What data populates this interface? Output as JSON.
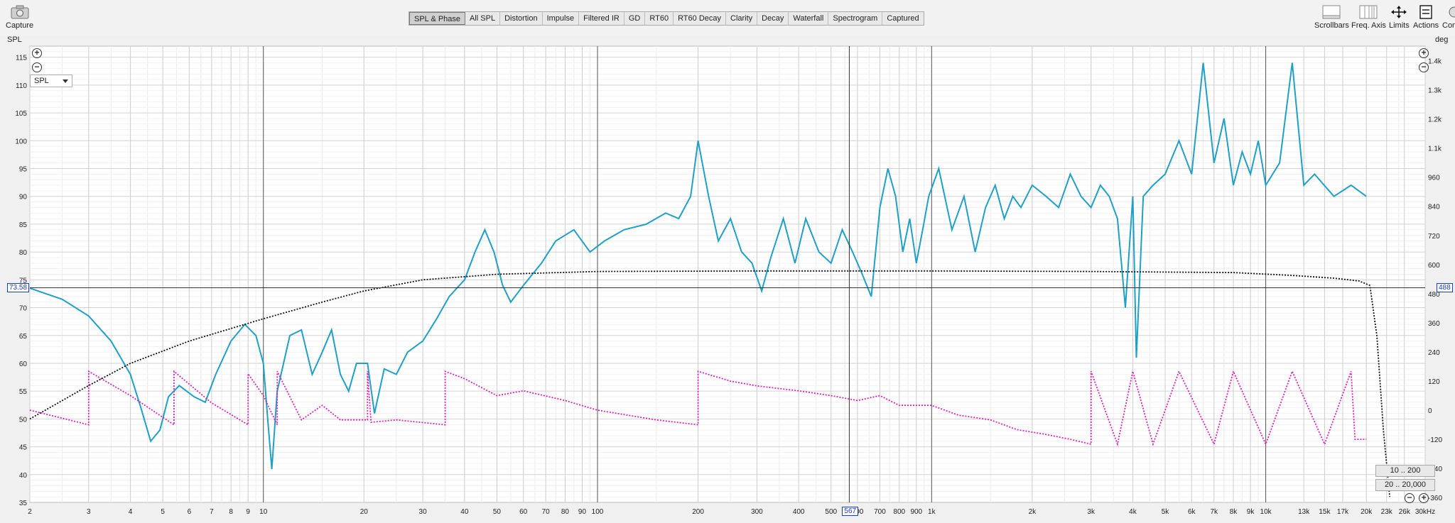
{
  "toolbar": {
    "capture_label": "Capture",
    "tabs": [
      "SPL & Phase",
      "All SPL",
      "Distortion",
      "Impulse",
      "Filtered IR",
      "GD",
      "RT60",
      "RT60 Decay",
      "Clarity",
      "Decay",
      "Waterfall",
      "Spectrogram",
      "Captured"
    ],
    "active_tab": "SPL & Phase",
    "right_buttons": [
      "Scrollbars",
      "Freq. Axis",
      "Limits",
      "Actions",
      "Con"
    ]
  },
  "plot": {
    "left_unit": "SPL",
    "right_unit": "deg",
    "dropdown_value": "SPL",
    "cursor_left_value": "73.58",
    "cursor_right_value": "488",
    "cursor_freq_value": "567",
    "range_buttons": [
      "10 .. 200",
      "20 .. 20,000"
    ],
    "colors": {
      "spl": "#1ea0c8",
      "phase": "#e020b8",
      "group": "#111111",
      "grid": "#d8d8d8",
      "cursor": "#333333"
    }
  },
  "chart_data": {
    "type": "line",
    "x_scale": "log",
    "xlim": [
      2,
      30000
    ],
    "ylim": [
      35,
      117
    ],
    "y2lim": [
      -380,
      1500
    ],
    "x_ticks": [
      {
        "v": 2,
        "l": "2"
      },
      {
        "v": 3,
        "l": "3"
      },
      {
        "v": 4,
        "l": "4"
      },
      {
        "v": 5,
        "l": "5"
      },
      {
        "v": 6,
        "l": "6"
      },
      {
        "v": 7,
        "l": "7"
      },
      {
        "v": 8,
        "l": "8"
      },
      {
        "v": 9,
        "l": "9"
      },
      {
        "v": 10,
        "l": "10"
      },
      {
        "v": 20,
        "l": "20"
      },
      {
        "v": 30,
        "l": "30"
      },
      {
        "v": 40,
        "l": "40"
      },
      {
        "v": 50,
        "l": "50"
      },
      {
        "v": 60,
        "l": "60"
      },
      {
        "v": 70,
        "l": "70"
      },
      {
        "v": 80,
        "l": "80"
      },
      {
        "v": 90,
        "l": "90"
      },
      {
        "v": 100,
        "l": "100"
      },
      {
        "v": 200,
        "l": "200"
      },
      {
        "v": 300,
        "l": "300"
      },
      {
        "v": 400,
        "l": "400"
      },
      {
        "v": 500,
        "l": "500"
      },
      {
        "v": 600,
        "l": "600"
      },
      {
        "v": 700,
        "l": "700"
      },
      {
        "v": 800,
        "l": "800"
      },
      {
        "v": 900,
        "l": "900"
      },
      {
        "v": 1000,
        "l": "1k"
      },
      {
        "v": 2000,
        "l": "2k"
      },
      {
        "v": 3000,
        "l": "3k"
      },
      {
        "v": 4000,
        "l": "4k"
      },
      {
        "v": 5000,
        "l": "5k"
      },
      {
        "v": 6000,
        "l": "6k"
      },
      {
        "v": 7000,
        "l": "7k"
      },
      {
        "v": 8000,
        "l": "8k"
      },
      {
        "v": 9000,
        "l": "9k"
      },
      {
        "v": 10000,
        "l": "10k"
      },
      {
        "v": 13000,
        "l": "13k"
      },
      {
        "v": 15000,
        "l": "15k"
      },
      {
        "v": 17000,
        "l": "17k"
      },
      {
        "v": 20000,
        "l": "20k"
      },
      {
        "v": 23000,
        "l": "23k"
      },
      {
        "v": 26000,
        "l": "26k"
      },
      {
        "v": 30000,
        "l": "30kHz"
      }
    ],
    "y_ticks": [
      40,
      45,
      50,
      55,
      60,
      65,
      70,
      75,
      80,
      85,
      90,
      95,
      100,
      105,
      110,
      115
    ],
    "y2_ticks": [
      -360,
      -240,
      -120,
      0,
      120,
      240,
      360,
      480,
      600,
      720,
      840,
      960,
      1080,
      1200,
      1320,
      1440
    ],
    "y2_tick_labels": [
      "-360",
      "-240",
      "-120",
      "0",
      "120",
      "240",
      "360",
      "480",
      "600",
      "720",
      "840",
      "960",
      "1.1k",
      "1.2k",
      "1.3k",
      "1.4k"
    ],
    "cursor": {
      "x": 567,
      "y": 73.58
    },
    "series": [
      {
        "key": "spl",
        "points": [
          [
            2,
            73.5
          ],
          [
            2.5,
            71.5
          ],
          [
            3,
            68.5
          ],
          [
            3.5,
            64
          ],
          [
            4,
            58
          ],
          [
            4.3,
            52
          ],
          [
            4.6,
            46
          ],
          [
            4.9,
            48
          ],
          [
            5.2,
            54
          ],
          [
            5.6,
            56
          ],
          [
            6.2,
            54
          ],
          [
            6.7,
            53
          ],
          [
            7.2,
            58
          ],
          [
            8,
            64
          ],
          [
            8.8,
            67
          ],
          [
            9.5,
            65
          ],
          [
            10,
            60
          ],
          [
            10.3,
            50
          ],
          [
            10.6,
            41
          ],
          [
            11,
            55
          ],
          [
            12,
            65
          ],
          [
            13,
            66
          ],
          [
            14,
            58
          ],
          [
            15,
            62
          ],
          [
            16,
            66
          ],
          [
            17,
            58
          ],
          [
            18,
            55
          ],
          [
            19,
            60
          ],
          [
            20.5,
            60
          ],
          [
            21.5,
            51
          ],
          [
            23,
            59
          ],
          [
            25,
            58
          ],
          [
            27,
            62
          ],
          [
            30,
            64
          ],
          [
            33,
            68
          ],
          [
            36,
            72
          ],
          [
            40,
            75
          ],
          [
            43,
            80
          ],
          [
            46,
            84
          ],
          [
            49,
            80
          ],
          [
            52,
            74
          ],
          [
            55,
            71
          ],
          [
            60,
            74
          ],
          [
            68,
            78
          ],
          [
            75,
            82
          ],
          [
            85,
            84
          ],
          [
            95,
            80
          ],
          [
            105,
            82
          ],
          [
            120,
            84
          ],
          [
            140,
            85
          ],
          [
            160,
            87
          ],
          [
            175,
            86
          ],
          [
            190,
            90
          ],
          [
            200,
            100
          ],
          [
            215,
            90
          ],
          [
            230,
            82
          ],
          [
            250,
            86
          ],
          [
            270,
            80
          ],
          [
            290,
            78
          ],
          [
            310,
            73
          ],
          [
            330,
            79
          ],
          [
            360,
            86
          ],
          [
            390,
            78
          ],
          [
            420,
            86
          ],
          [
            460,
            80
          ],
          [
            500,
            78
          ],
          [
            540,
            84
          ],
          [
            580,
            80
          ],
          [
            620,
            76
          ],
          [
            660,
            72
          ],
          [
            700,
            88
          ],
          [
            740,
            95
          ],
          [
            780,
            90
          ],
          [
            820,
            80
          ],
          [
            860,
            86
          ],
          [
            900,
            78
          ],
          [
            940,
            84
          ],
          [
            980,
            90
          ],
          [
            1050,
            95
          ],
          [
            1150,
            84
          ],
          [
            1250,
            90
          ],
          [
            1350,
            80
          ],
          [
            1450,
            88
          ],
          [
            1550,
            92
          ],
          [
            1650,
            86
          ],
          [
            1750,
            90
          ],
          [
            1850,
            88
          ],
          [
            2000,
            92
          ],
          [
            2200,
            90
          ],
          [
            2400,
            88
          ],
          [
            2600,
            94
          ],
          [
            2800,
            90
          ],
          [
            3000,
            88
          ],
          [
            3200,
            92
          ],
          [
            3400,
            90
          ],
          [
            3600,
            86
          ],
          [
            3800,
            70
          ],
          [
            4000,
            90
          ],
          [
            4100,
            61
          ],
          [
            4300,
            90
          ],
          [
            4600,
            92
          ],
          [
            5000,
            94
          ],
          [
            5500,
            100
          ],
          [
            6000,
            94
          ],
          [
            6500,
            114
          ],
          [
            7000,
            96
          ],
          [
            7500,
            104
          ],
          [
            8000,
            92
          ],
          [
            8500,
            98
          ],
          [
            9000,
            94
          ],
          [
            9500,
            100
          ],
          [
            10000,
            92
          ],
          [
            11000,
            96
          ],
          [
            12000,
            114
          ],
          [
            13000,
            92
          ],
          [
            14000,
            94
          ],
          [
            16000,
            90
          ],
          [
            18000,
            92
          ],
          [
            20000,
            90
          ]
        ]
      },
      {
        "key": "phase",
        "points": [
          [
            2,
            0
          ],
          [
            3,
            -60
          ],
          [
            3,
            160
          ],
          [
            4,
            60
          ],
          [
            5.4,
            -60
          ],
          [
            5.4,
            160
          ],
          [
            7,
            30
          ],
          [
            9,
            -60
          ],
          [
            9,
            150
          ],
          [
            10,
            60
          ],
          [
            11,
            -60
          ],
          [
            11,
            160
          ],
          [
            13,
            -40
          ],
          [
            15,
            20
          ],
          [
            17,
            -40
          ],
          [
            20.5,
            -40
          ],
          [
            20.5,
            160
          ],
          [
            21,
            -50
          ],
          [
            25,
            -40
          ],
          [
            35,
            -60
          ],
          [
            35,
            160
          ],
          [
            40,
            130
          ],
          [
            50,
            60
          ],
          [
            60,
            80
          ],
          [
            80,
            40
          ],
          [
            100,
            0
          ],
          [
            150,
            -40
          ],
          [
            200,
            -60
          ],
          [
            200,
            160
          ],
          [
            250,
            120
          ],
          [
            300,
            100
          ],
          [
            400,
            80
          ],
          [
            500,
            60
          ],
          [
            600,
            40
          ],
          [
            700,
            60
          ],
          [
            800,
            20
          ],
          [
            1000,
            20
          ],
          [
            1200,
            -20
          ],
          [
            1500,
            -40
          ],
          [
            1800,
            -80
          ],
          [
            2200,
            -100
          ],
          [
            2600,
            -120
          ],
          [
            3000,
            -140
          ],
          [
            3000,
            160
          ],
          [
            3600,
            -140
          ],
          [
            4000,
            160
          ],
          [
            4600,
            -140
          ],
          [
            5500,
            160
          ],
          [
            7000,
            -140
          ],
          [
            8000,
            160
          ],
          [
            10000,
            -140
          ],
          [
            12000,
            160
          ],
          [
            15000,
            -140
          ],
          [
            18000,
            160
          ],
          [
            18500,
            -120
          ],
          [
            20000,
            -120
          ]
        ]
      },
      {
        "key": "group",
        "points": [
          [
            2,
            50
          ],
          [
            3,
            56
          ],
          [
            4,
            60
          ],
          [
            6,
            64
          ],
          [
            10,
            68
          ],
          [
            15,
            71
          ],
          [
            20,
            73
          ],
          [
            30,
            75
          ],
          [
            50,
            76
          ],
          [
            100,
            76.5
          ],
          [
            300,
            76.6
          ],
          [
            1000,
            76.6
          ],
          [
            3000,
            76.5
          ],
          [
            8000,
            76.3
          ],
          [
            12000,
            75.8
          ],
          [
            16000,
            75.3
          ],
          [
            19000,
            74.8
          ],
          [
            20500,
            74
          ],
          [
            21500,
            65
          ],
          [
            22500,
            48
          ],
          [
            23500,
            36
          ]
        ]
      }
    ]
  }
}
